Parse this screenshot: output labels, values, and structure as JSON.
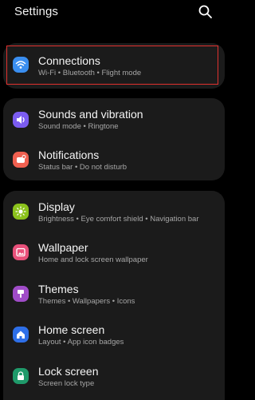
{
  "header": {
    "title": "Settings",
    "search_icon": "search-icon"
  },
  "colors": {
    "background": "#000000",
    "card": "#1b1b1b",
    "highlight": "#e0312f",
    "connections_icon": "#3a8ef0",
    "sounds_icon": "#7b5cf0",
    "notifications_icon": "#f06050",
    "display_icon": "#8bc21c",
    "wallpaper_icon": "#e8507a",
    "themes_icon": "#a04cc8",
    "home_icon": "#2e6fe8",
    "lock_icon": "#1f9a6a"
  },
  "items": {
    "connections": {
      "label": "Connections",
      "sub": "Wi-Fi  •  Bluetooth  •  Flight mode",
      "icon": "wifi-icon"
    },
    "sounds": {
      "label": "Sounds and vibration",
      "sub": "Sound mode  •  Ringtone",
      "icon": "volume-icon"
    },
    "notifications": {
      "label": "Notifications",
      "sub": "Status bar  •  Do not disturb",
      "icon": "notification-icon"
    },
    "display": {
      "label": "Display",
      "sub": "Brightness  •  Eye comfort shield  •  Navigation bar",
      "icon": "sun-icon"
    },
    "wallpaper": {
      "label": "Wallpaper",
      "sub": "Home and lock screen wallpaper",
      "icon": "image-icon"
    },
    "themes": {
      "label": "Themes",
      "sub": "Themes  •  Wallpapers  •  Icons",
      "icon": "brush-icon"
    },
    "home": {
      "label": "Home screen",
      "sub": "Layout  •  App icon badges",
      "icon": "home-icon"
    },
    "lock": {
      "label": "Lock screen",
      "sub": "Screen lock type",
      "icon": "lock-icon"
    }
  }
}
